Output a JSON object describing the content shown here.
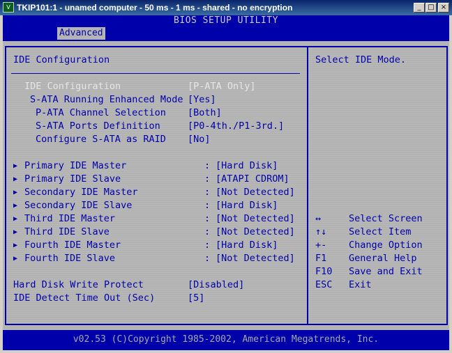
{
  "window": {
    "title": "TKIP101:1 - unamed computer - 50 ms - 1 ms - shared - no encryption",
    "icon": "vnc-icon",
    "buttons": {
      "minimize": "_",
      "maximize": "□",
      "close": "×"
    }
  },
  "bios": {
    "header_title": "BIOS SETUP UTILITY",
    "active_tab": "Advanced",
    "section_title": "IDE Configuration",
    "help_text": "Select IDE Mode.",
    "settings": [
      {
        "label": "IDE Configuration",
        "value": "[P-ATA Only]",
        "grayed": true
      },
      {
        "label": "S-ATA Running Enhanced Mode",
        "value": "[Yes]",
        "grayed": false
      },
      {
        "label": "P-ATA Channel Selection",
        "value": "[Both]",
        "grayed": true
      },
      {
        "label": "S-ATA Ports Definition",
        "value": "[P0-4th./P1-3rd.]",
        "grayed": true
      },
      {
        "label": "Configure S-ATA as RAID",
        "value": "[No]",
        "grayed": false
      }
    ],
    "devices": [
      {
        "label": "Primary IDE Master",
        "value": "[Hard Disk]"
      },
      {
        "label": "Primary IDE Slave",
        "value": "[ATAPI CDROM]"
      },
      {
        "label": "Secondary IDE Master",
        "value": "[Not Detected]"
      },
      {
        "label": "Secondary IDE Slave",
        "value": "[Hard Disk]"
      },
      {
        "label": "Third IDE Master",
        "value": "[Not Detected]"
      },
      {
        "label": "Third IDE Slave",
        "value": "[Not Detected]"
      },
      {
        "label": "Fourth IDE Master",
        "value": "[Hard Disk]"
      },
      {
        "label": "Fourth IDE Slave",
        "value": "[Not Detected]"
      }
    ],
    "device_arrow": "▶",
    "device_separator": ":",
    "options": [
      {
        "label": "Hard Disk Write Protect",
        "value": "[Disabled]"
      },
      {
        "label": "IDE Detect Time Out (Sec)",
        "value": "[5]"
      }
    ],
    "keys": [
      {
        "key": "↔",
        "action": "Select Screen"
      },
      {
        "key": "↑↓",
        "action": "Select Item"
      },
      {
        "key": "+-",
        "action": "Change Option"
      },
      {
        "key": "F1",
        "action": "General Help"
      },
      {
        "key": "F10",
        "action": "Save and Exit"
      },
      {
        "key": "ESC",
        "action": "Exit"
      }
    ],
    "footer": "v02.53 (C)Copyright 1985-2002, American Megatrends, Inc."
  },
  "colors": {
    "bios_blue": "#0000aa",
    "bios_gray": "#b4b4b4",
    "highlight_white": "#e6e6e6"
  }
}
